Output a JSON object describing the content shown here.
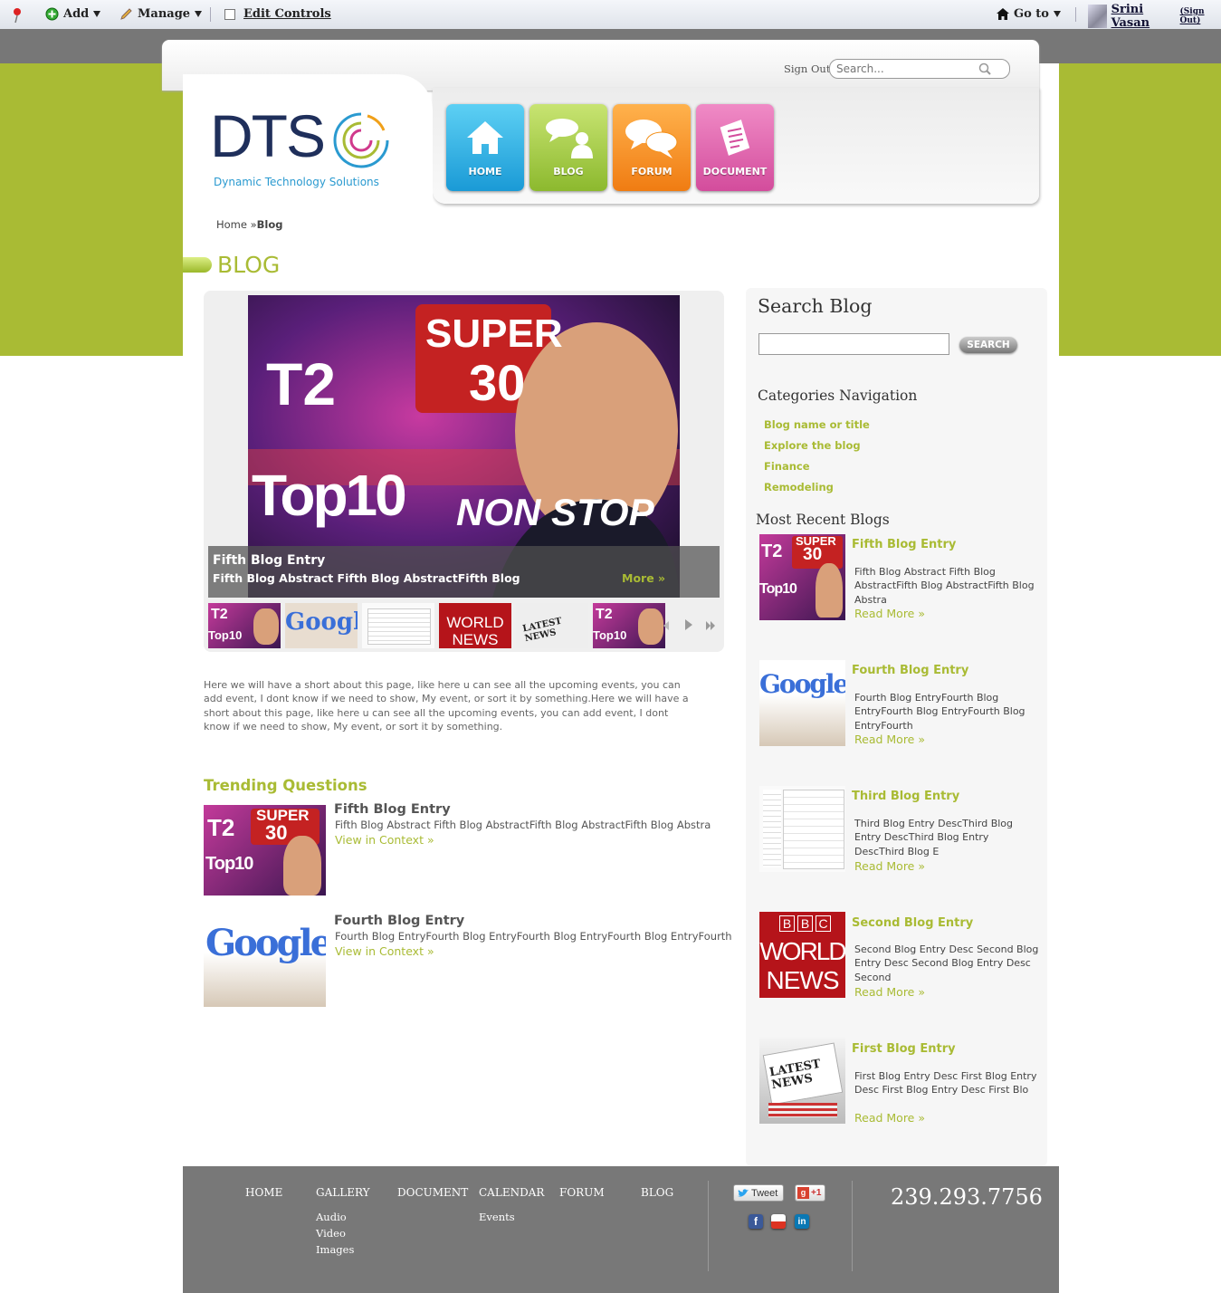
{
  "admin_bar": {
    "add": "Add",
    "manage": "Manage",
    "edit_controls": "Edit Controls",
    "goto": "Go to",
    "user": "Srini Vasan",
    "sign_out": "(Sign Out)"
  },
  "header": {
    "sign_out": "Sign Out",
    "search_placeholder": "Search...",
    "logo_text": "DTS",
    "logo_tagline": "Dynamic Technology Solutions"
  },
  "nav": [
    {
      "label": "HOME",
      "color": "#1ea5dc"
    },
    {
      "label": "BLOG",
      "color": "#9cc43a"
    },
    {
      "label": "FORUM",
      "color": "#f39019"
    },
    {
      "label": "DOCUMENT",
      "color": "#dd5ca7"
    }
  ],
  "breadcrumb": {
    "home": "Home",
    "separator": "»",
    "current": "Blog"
  },
  "page_title": "BLOG",
  "slider": {
    "title": "Fifth Blog Entry",
    "abstract": "Fifth Blog Abstract Fifth Blog AbstractFifth Blog",
    "more": "More »"
  },
  "intro": "Here we will have a short about this page, like here u can see all the upcoming events, you can add event, I dont know if we need to show, My event, or sort it by something.Here we will have a short about this page, like here u can see all the upcoming events, you can add event, I dont know if we need to show, My event, or sort it by something.",
  "trending": {
    "heading": "Trending Questions",
    "items": [
      {
        "title": "Fifth Blog Entry",
        "desc": "Fifth Blog Abstract Fifth Blog AbstractFifth Blog AbstractFifth Blog Abstra",
        "link": "View in Context »"
      },
      {
        "title": "Fourth Blog Entry",
        "desc": "Fourth Blog EntryFourth Blog EntryFourth Blog EntryFourth Blog EntryFourth",
        "link": "View in Context »"
      }
    ]
  },
  "sidebar": {
    "search_heading": "Search Blog",
    "search_button": "SEARCH",
    "categories_heading": "Categories Navigation",
    "categories": [
      "Blog name or title",
      "Explore the blog",
      "Finance",
      "Remodeling"
    ],
    "recent_heading": "Most Recent Blogs",
    "recent": [
      {
        "title": "Fifth Blog Entry",
        "desc": "Fifth Blog Abstract Fifth Blog AbstractFifth Blog AbstractFifth Blog Abstra",
        "more": "Read More »"
      },
      {
        "title": "Fourth Blog Entry",
        "desc": "Fourth Blog EntryFourth Blog EntryFourth Blog EntryFourth Blog EntryFourth",
        "more": "Read More »"
      },
      {
        "title": "Third Blog Entry",
        "desc": "Third Blog Entry DescThird Blog Entry DescThird Blog Entry DescThird Blog E",
        "more": "Read More »"
      },
      {
        "title": "Second Blog Entry",
        "desc": "Second Blog Entry Desc Second Blog Entry Desc Second Blog Entry Desc Second",
        "more": "Read More »"
      },
      {
        "title": "First Blog Entry",
        "desc": "First Blog Entry Desc First Blog Entry Desc First Blog Entry Desc First Blo",
        "more": "Read More »"
      }
    ]
  },
  "images": {
    "t20_super": "SUPER",
    "t20_30": "30",
    "t20_t2": "T2",
    "t20_top10": "Top10",
    "t20_nonstop": "NON STOP",
    "google": "Google",
    "bbc_letters": [
      "B",
      "B",
      "C"
    ],
    "bbc_world": "WORLD",
    "bbc_news": "NEWS",
    "latest_news": "LATEST NEWS"
  },
  "footer": {
    "nav": [
      "HOME",
      "GALLERY",
      "DOCUMENT",
      "CALENDAR",
      "FORUM",
      "BLOG"
    ],
    "gallery_sub": [
      "Audio",
      "Video",
      "Images"
    ],
    "calendar_sub": [
      "Events"
    ],
    "tweet": "Tweet",
    "gplus": "+1",
    "phone": "239.293.7756"
  }
}
